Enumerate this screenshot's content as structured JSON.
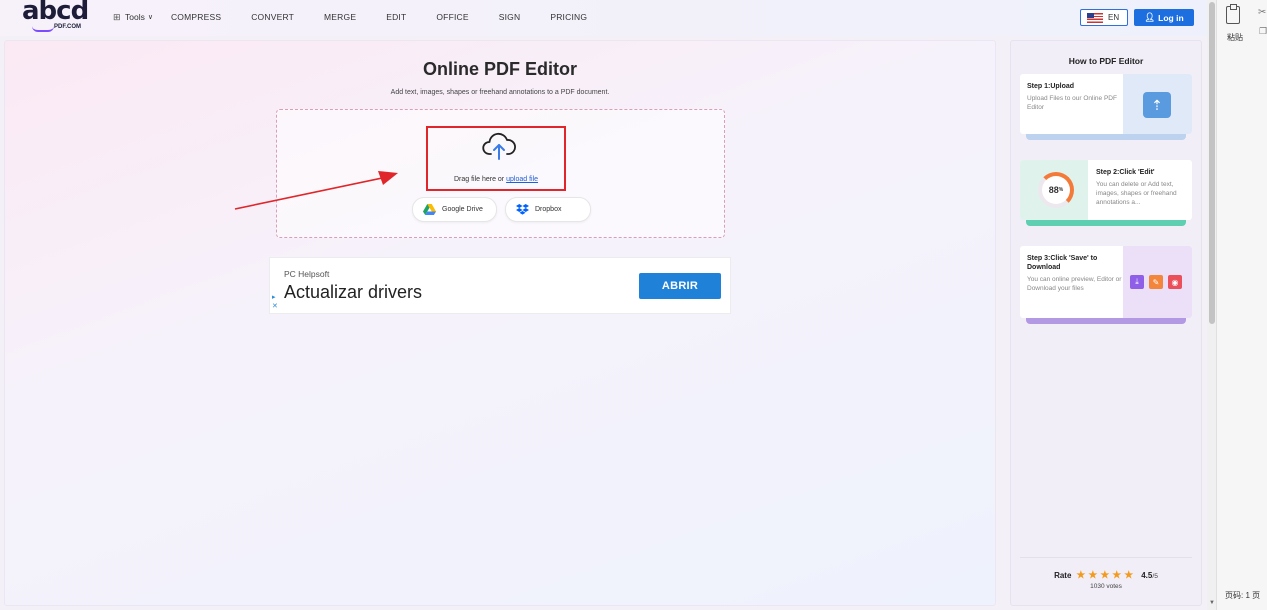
{
  "nav": {
    "logo": "abcd",
    "logo_sub": "PDF.COM",
    "tools_label": "Tools",
    "items": [
      "COMPRESS",
      "CONVERT",
      "MERGE",
      "EDIT",
      "OFFICE",
      "SIGN",
      "PRICING"
    ],
    "lang": "EN",
    "login": "Log in"
  },
  "main": {
    "title": "Online PDF Editor",
    "subtitle": "Add text, images, shapes or freehand annotations to a PDF document.",
    "drag_text": "Drag file here or",
    "upload_link": "upload file",
    "google_drive": "Google Drive",
    "dropbox": "Dropbox"
  },
  "ad": {
    "brand": "PC Helpsoft",
    "headline": "Actualizar drivers",
    "cta": "ABRIR"
  },
  "sidebar": {
    "title": "How to PDF Editor",
    "steps": [
      {
        "title": "Step 1:Upload",
        "desc": "Upload Files to our Online PDF Editor"
      },
      {
        "title": "Step 2:Click 'Edit'",
        "desc": "You can delete or Add text, images, shapes or freehand annotations a..."
      },
      {
        "title": "Step 3:Click 'Save' to Download",
        "desc": "You can online preview, Editor or Download your files"
      }
    ],
    "gauge_value": "88",
    "gauge_unit": "%",
    "rate_label": "Rate",
    "rating": "4.5",
    "rating_max": "/5",
    "stars": 4.5,
    "votes": "1030 votes"
  },
  "app_strip": {
    "paste_label": "粘贴",
    "page_label": "页码: 1  页"
  },
  "colors": {
    "accent": "#1d6fe0",
    "highlight": "#e0262a",
    "star": "#f39a1c"
  }
}
